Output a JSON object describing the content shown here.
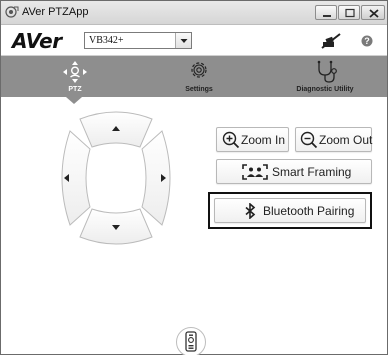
{
  "window": {
    "title": "AVer PTZApp",
    "icon": "app-camera-icon"
  },
  "header": {
    "logo": "AVer",
    "camera_select": {
      "value": "VB342+"
    },
    "mute_icon": "microphone-muted-icon",
    "help_icon": "help-icon"
  },
  "nav": {
    "items": [
      {
        "label": "PTZ",
        "icon": "ptz-icon",
        "active": true
      },
      {
        "label": "Settings",
        "icon": "gear-icon",
        "active": false
      },
      {
        "label": "Diagnostic Utility",
        "icon": "stethoscope-icon",
        "active": false
      }
    ]
  },
  "ptz": {
    "buttons": [
      {
        "name": "pan-up-button",
        "icon": "arrow-up-icon"
      },
      {
        "name": "pan-left-button",
        "icon": "arrow-left-icon"
      },
      {
        "name": "pan-right-button",
        "icon": "arrow-right-icon"
      },
      {
        "name": "pan-down-button",
        "icon": "arrow-down-icon"
      }
    ]
  },
  "controls": {
    "zoom_in": "Zoom In",
    "zoom_out": "Zoom Out",
    "smart_framing": "Smart Framing",
    "bluetooth_pairing": "Bluetooth Pairing"
  },
  "footer": {
    "remote_icon": "remote-control-icon"
  },
  "colors": {
    "nav_bar": "#8e8e8e",
    "highlight_outline": "#111111"
  }
}
